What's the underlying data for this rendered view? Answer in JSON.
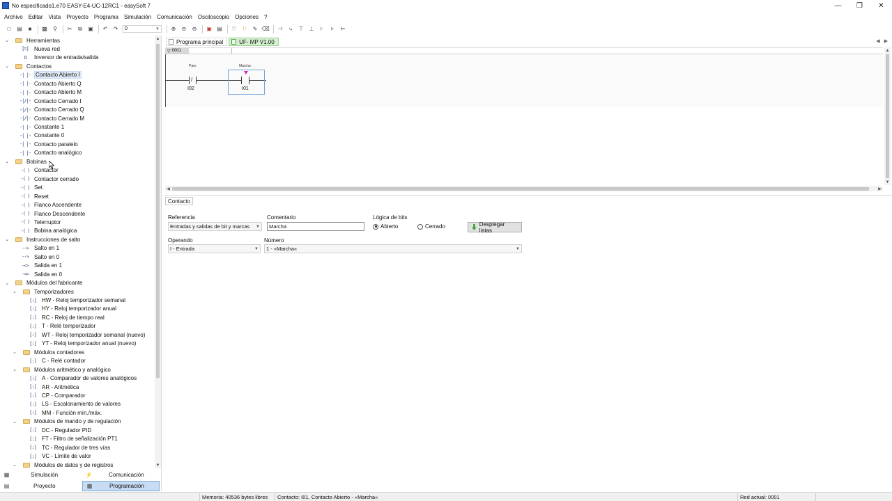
{
  "window": {
    "title": "No especificado1.e70 EASY-E4-UC-12RC1 - easySoft 7"
  },
  "menu": [
    "Archivo",
    "Editar",
    "Vista",
    "Proyecto",
    "Programa",
    "Simulación",
    "Comunicación",
    "Osciloscopio",
    "Opciones",
    "?"
  ],
  "toolbar": {
    "zoom_value": "0"
  },
  "tree": {
    "herramientas": "Herramientas",
    "nueva_red": "Nueva red",
    "inversor": "Inversor de entrada/salida",
    "contactos": "Contactos",
    "contactos_items": [
      "Contacto Abierto I",
      "Contacto Abierto Q",
      "Contacto Abierto M",
      "Contacto Cerrado I",
      "Contacto Cerrado Q",
      "Contacto Cerrado M",
      "Constante 1",
      "Constante 0",
      "Contacto paralelo",
      "Contacto analógico"
    ],
    "bobinas": "Bobinas",
    "bobinas_items": [
      "Contactor",
      "Contactor cerrado",
      "Set",
      "Reset",
      "Flanco Ascendente",
      "Flanco Descendente",
      "Telerruptor",
      "Bobina analógica"
    ],
    "salto": "Instrucciones de salto",
    "salto_items": [
      "Salto en 1",
      "Salto en 0",
      "Salida en 1",
      "Salida en 0"
    ],
    "fabricante": "Módulos del fabricante",
    "temporizadores": "Temporizadores",
    "temporizadores_items": [
      "HW - Reloj temporizador semanal",
      "HY - Reloj temporizador anual",
      "RC - Reloj de tiempo real",
      "T - Relé temporizador",
      "WT - Reloj temporizador semanal (nuevo)",
      "YT - Reloj temporizador anual (nuevo)"
    ],
    "contadores": "Módulos contadores",
    "contadores_items": [
      "C - Relé contador"
    ],
    "aritmetico": "Módulos aritmético y analógico",
    "aritmetico_items": [
      "A - Comparador de valores analógicos",
      "AR - Aritmética",
      "CP - Comparador",
      "LS - Escalonamiento de valores",
      "MM - Función mín./máx."
    ],
    "mando": "Módulos de mando y de regulación",
    "mando_items": [
      "DC - Regulador PID",
      "FT - Filtro de señalización PT1",
      "TC - Regulador de tres vías",
      "VC - Límite de valor"
    ],
    "datos": "Módulos de datos y de registros"
  },
  "left_tabs": {
    "simulacion": "Simulación",
    "comunicacion": "Comunicación",
    "proyecto": "Proyecto",
    "programacion": "Programación"
  },
  "editor": {
    "tab_main": "Programa principal",
    "tab_uf": "UF- MP V1.00",
    "rung_number": "0001",
    "contact1": {
      "comment": "Paro",
      "address": "I02"
    },
    "contact2": {
      "comment": "Marcha",
      "address": "I01"
    }
  },
  "props": {
    "tab": "Contacto",
    "referencia_label": "Referencia",
    "referencia_value": "Entradas y salidas de bit y marcas",
    "comentario_label": "Comentario",
    "comentario_value": "Marcha",
    "logica_label": "Lógica de bits",
    "abierto": "Abierto",
    "cerrado": "Cerrado",
    "desplegar": "Desplegar listas",
    "operando_label": "Operando",
    "operando_value": "I - Entrada",
    "numero_label": "Número",
    "numero_value": "1 - «Marcha«"
  },
  "status": {
    "memoria": "Memoria: 40536 bytes libres",
    "contacto": "Contacto: I01, Contacto Abierto - «Marcha«",
    "red": "Red actual: 0001"
  }
}
